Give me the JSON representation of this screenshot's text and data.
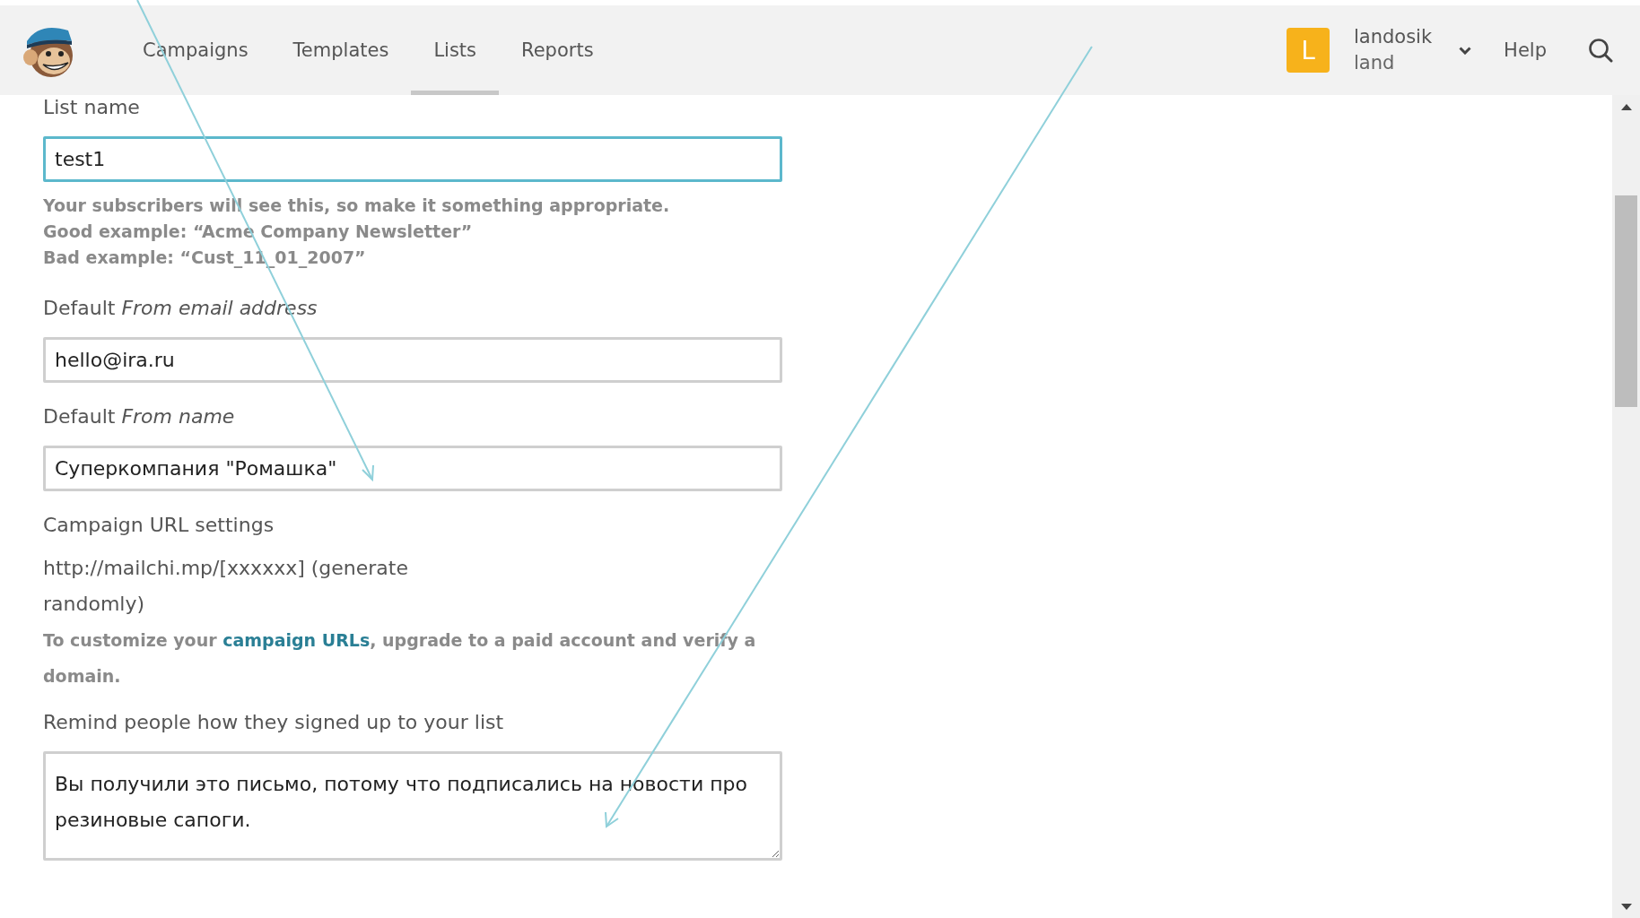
{
  "header": {
    "tabs": [
      {
        "label": "Campaigns",
        "selected": false
      },
      {
        "label": "Templates",
        "selected": false
      },
      {
        "label": "Lists",
        "selected": true
      },
      {
        "label": "Reports",
        "selected": false
      }
    ],
    "account": {
      "avatar_letter": "L",
      "username": "landosik",
      "account_name": "land"
    },
    "help": "Help"
  },
  "form": [
    {
      "kind": "input",
      "label": "List name",
      "value": "test1",
      "focused": true,
      "hints": [
        "Your subscribers will see this, so make it something appropriate.",
        "Good example: “Acme Company Newsletter”",
        "Bad example: “Cust_11_01_2007”"
      ]
    },
    {
      "kind": "input",
      "label": "Default *From email address*",
      "value": "hello@ira.ru",
      "focused": false
    },
    {
      "kind": "input",
      "label": "Default *From name*",
      "value": "Суперкомпания \"Ромашка\"",
      "focused": false
    },
    {
      "kind": "url",
      "label": "Campaign URL settings",
      "text": "http://mailchi.mp/[xxxxxx] (generate randomly)",
      "note_before": "To customize your ",
      "note_link": "campaign URLs",
      "note_after": ", upgrade to a paid account and verify a domain."
    },
    {
      "kind": "textarea",
      "label": "Remind people how they signed up to your list",
      "value": "Вы получили это письмо, потому что подписались на новости про резиновые сапоги.",
      "focused": false
    }
  ]
}
